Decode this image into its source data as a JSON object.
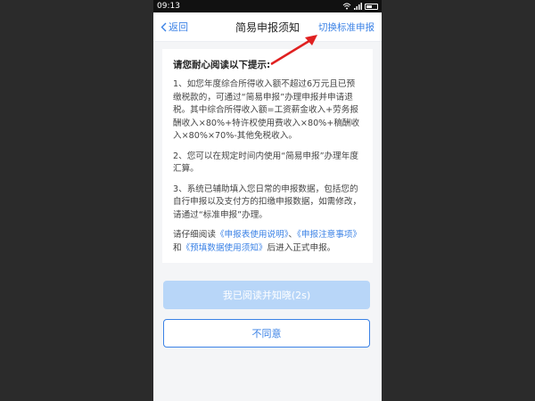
{
  "status": {
    "time": "09:13"
  },
  "nav": {
    "back_label": "返回",
    "title": "简易申报须知",
    "action_label": "切换标准申报"
  },
  "notice": {
    "heading": "请您耐心阅读以下提示:",
    "p1": "1、如您年度综合所得收入额不超过6万元且已预缴税款的，可通过“简易申报”办理申报并申请退税。其中综合所得收入额=工资薪金收入+劳务报酬收入×80%+特许权使用费收入×80%+稿酬收入×80%×70%-其他免税收入。",
    "p2": "2、您可以在规定时间内使用“简易申报”办理年度汇算。",
    "p3": "3、系统已辅助填入您日常的申报数据，包括您的自行申报以及支付方的扣缴申报数据，如需修改，请通过“标准申报”办理。",
    "p4_prefix": "请仔细阅读",
    "link1": "《申报表使用说明》",
    "sep1": "、",
    "link2": "《申报注意事项》",
    "p4_and": "和",
    "link3": "《预填数据使用须知》",
    "p4_suffix": "后进入正式申报。"
  },
  "buttons": {
    "confirm_label": "我已阅读并知晓(2s)",
    "disagree_label": "不同意"
  },
  "colors": {
    "accent": "#3b82e6",
    "confirm_disabled": "#b8d6f8",
    "annotation_arrow": "#e02020"
  }
}
